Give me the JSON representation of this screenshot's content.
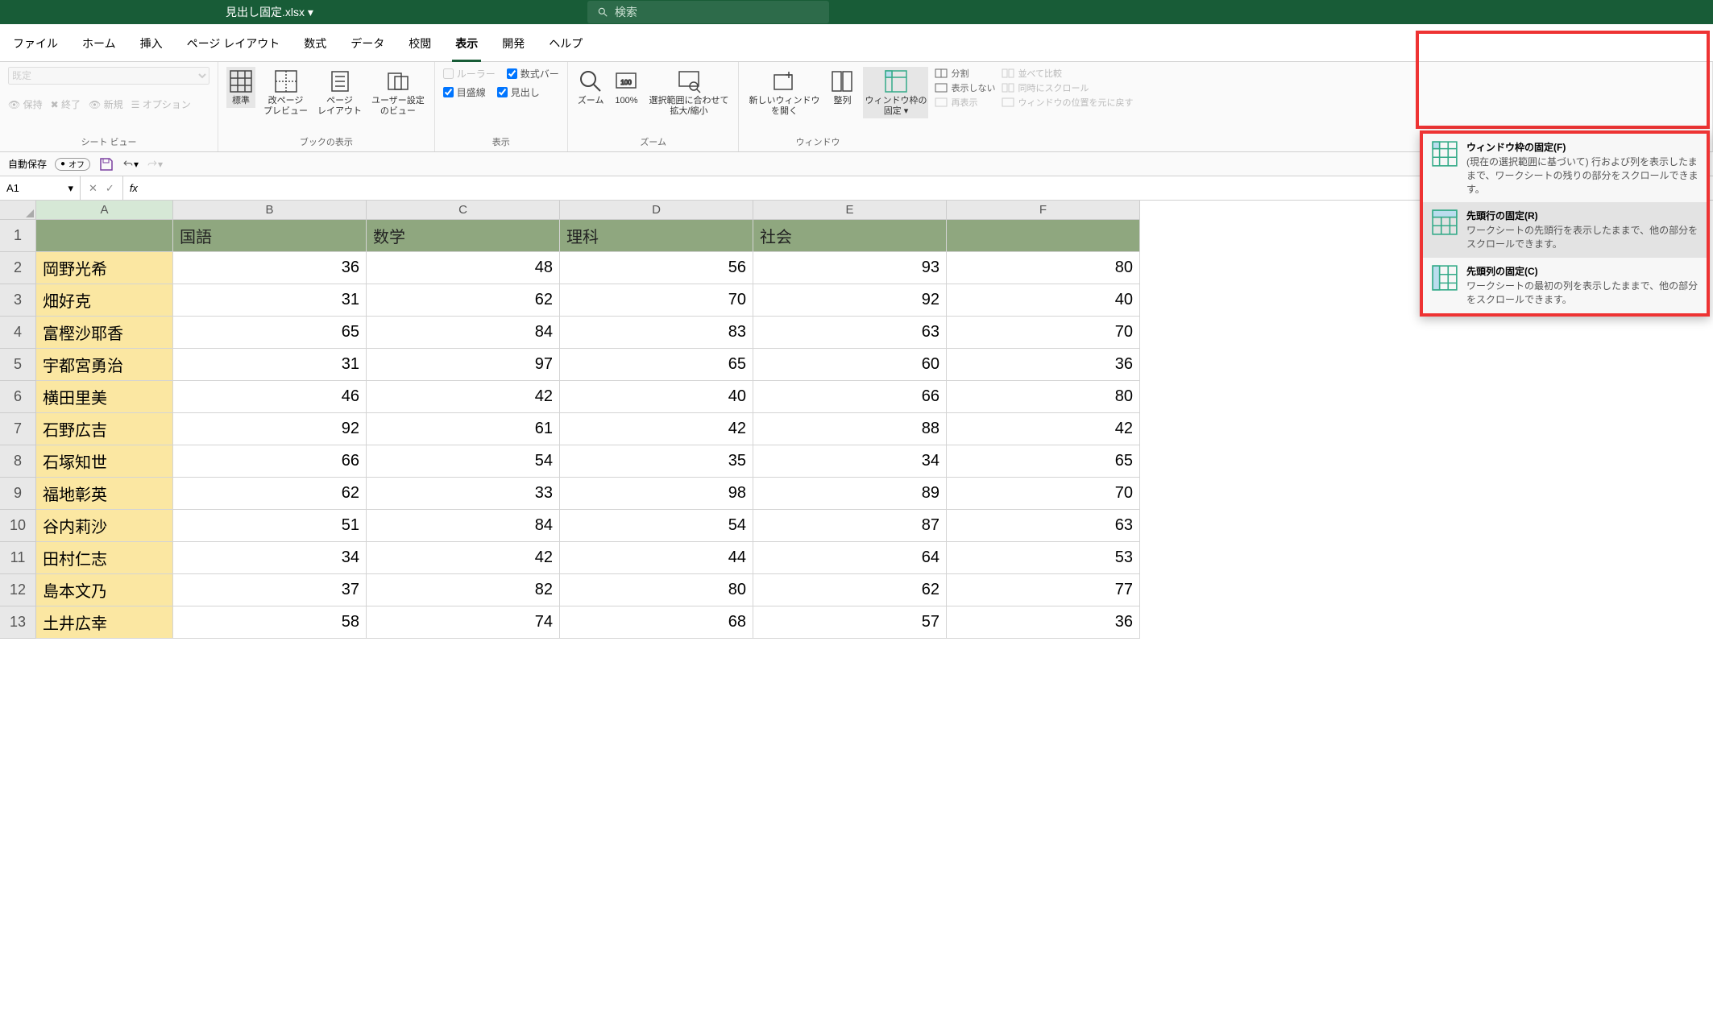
{
  "window": {
    "title": "見出し固定.xlsx ▾",
    "search_placeholder": "検索"
  },
  "menu": {
    "file": "ファイル",
    "home": "ホーム",
    "insert": "挿入",
    "pagelayout": "ページ レイアウト",
    "formulas": "数式",
    "data": "データ",
    "review": "校閲",
    "view": "表示",
    "developer": "開発",
    "help": "ヘルプ"
  },
  "ribbon": {
    "sheetview": {
      "label": "シート ビュー",
      "default_opt": "既定",
      "keep": "保持",
      "exit": "終了",
      "new": "新規",
      "options": "オプション"
    },
    "workbookviews": {
      "label": "ブックの表示",
      "normal": "標準",
      "pagebreak": "改ページ\nプレビュー",
      "pagelayout": "ページ\nレイアウト",
      "custom": "ユーザー設定\nのビュー"
    },
    "show": {
      "label": "表示",
      "ruler": "ルーラー",
      "formulabar": "数式バー",
      "gridlines": "目盛線",
      "headings": "見出し"
    },
    "zoom": {
      "label": "ズーム",
      "zoom": "ズーム",
      "hundred": "100%",
      "toselection": "選択範囲に合わせて\n拡大/縮小"
    },
    "window": {
      "label": "ウィンドウ",
      "newwindow": "新しいウィンドウ\nを開く",
      "arrange": "整列",
      "freeze": "ウィンドウ枠の\n固定 ▾",
      "split": "分割",
      "hide": "表示しない",
      "unhide": "再表示",
      "sidebyside": "並べて比較",
      "syncscroll": "同時にスクロール",
      "resetpos": "ウィンドウの位置を元に戻す"
    }
  },
  "qat": {
    "autosave": "自動保存",
    "off": "オフ"
  },
  "namebox": {
    "ref": "A1"
  },
  "sheet": {
    "cols": [
      "A",
      "B",
      "C",
      "D",
      "E",
      "F"
    ],
    "header_row": [
      "",
      "国語",
      "数学",
      "理科",
      "社会",
      ""
    ],
    "rows": [
      {
        "n": 2,
        "name": "岡野光希",
        "v": [
          36,
          48,
          56,
          93,
          80
        ]
      },
      {
        "n": 3,
        "name": "畑好克",
        "v": [
          31,
          62,
          70,
          92,
          40
        ]
      },
      {
        "n": 4,
        "name": "富樫沙耶香",
        "v": [
          65,
          84,
          83,
          63,
          70
        ]
      },
      {
        "n": 5,
        "name": "宇都宮勇治",
        "v": [
          31,
          97,
          65,
          60,
          36
        ]
      },
      {
        "n": 6,
        "name": "横田里美",
        "v": [
          46,
          42,
          40,
          66,
          80
        ]
      },
      {
        "n": 7,
        "name": "石野広吉",
        "v": [
          92,
          61,
          42,
          88,
          42
        ]
      },
      {
        "n": 8,
        "name": "石塚知世",
        "v": [
          66,
          54,
          35,
          34,
          65
        ]
      },
      {
        "n": 9,
        "name": "福地彰英",
        "v": [
          62,
          33,
          98,
          89,
          70
        ]
      },
      {
        "n": 10,
        "name": "谷内莉沙",
        "v": [
          51,
          84,
          54,
          87,
          63
        ]
      },
      {
        "n": 11,
        "name": "田村仁志",
        "v": [
          34,
          42,
          44,
          64,
          53
        ]
      },
      {
        "n": 12,
        "name": "島本文乃",
        "v": [
          37,
          82,
          80,
          62,
          77
        ]
      },
      {
        "n": 13,
        "name": "土井広幸",
        "v": [
          58,
          74,
          68,
          57,
          36
        ]
      }
    ]
  },
  "freeze_menu": {
    "item1": {
      "title": "ウィンドウ枠の固定(F)",
      "desc": "(現在の選択範囲に基づいて) 行および列を表示したままで、ワークシートの残りの部分をスクロールできます。"
    },
    "item2": {
      "title": "先頭行の固定(R)",
      "desc": "ワークシートの先頭行を表示したままで、他の部分をスクロールできます。"
    },
    "item3": {
      "title": "先頭列の固定(C)",
      "desc": "ワークシートの最初の列を表示したままで、他の部分をスクロールできます。"
    }
  }
}
